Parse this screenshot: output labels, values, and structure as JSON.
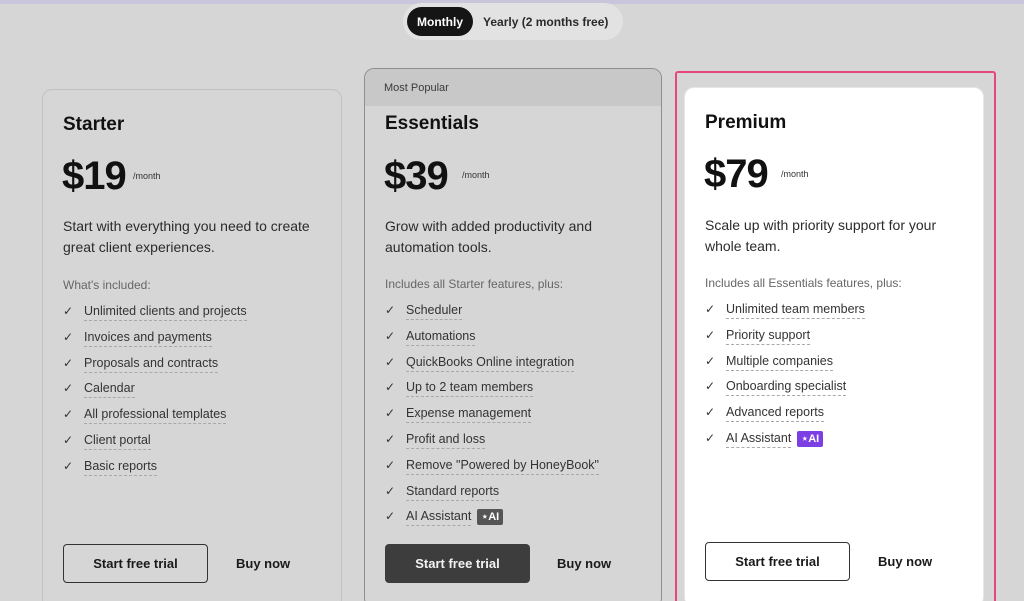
{
  "billing_toggle": {
    "monthly_label": "Monthly",
    "yearly_label": "Yearly (2 months free)",
    "selected": "Monthly"
  },
  "plans": [
    {
      "name": "Starter",
      "price": "$19",
      "period": "/month",
      "description": "Start with everything you need to create great client experiences.",
      "includes_label": "What's included:",
      "features": [
        "Unlimited clients and projects",
        "Invoices and payments",
        "Proposals and contracts",
        "Calendar",
        "All professional templates",
        "Client portal",
        "Basic reports"
      ],
      "trial_label": "Start free trial",
      "buy_label": "Buy now"
    },
    {
      "badge": "Most Popular",
      "name": "Essentials",
      "price": "$39",
      "period": "/month",
      "description": "Grow with added productivity and automation tools.",
      "includes_label": "Includes all Starter features, plus:",
      "features": [
        "Scheduler",
        "Automations",
        "QuickBooks Online integration",
        "Up to 2 team members",
        "Expense management",
        "Profit and loss",
        "Remove \"Powered by HoneyBook\"",
        "Standard reports",
        "AI Assistant"
      ],
      "ai_badge": "AI",
      "trial_label": "Start free trial",
      "buy_label": "Buy now"
    },
    {
      "name": "Premium",
      "price": "$79",
      "period": "/month",
      "description": "Scale up with priority support for your whole team.",
      "includes_label": "Includes all Essentials features, plus:",
      "features": [
        "Unlimited team members",
        "Priority support",
        "Multiple companies",
        "Onboarding specialist",
        "Advanced reports",
        "AI Assistant"
      ],
      "ai_badge": "AI",
      "trial_label": "Start free trial",
      "buy_label": "Buy now"
    }
  ],
  "colors": {
    "highlight_border": "#e8457e",
    "ai_badge_premium": "#7b3fe4",
    "ai_badge_muted": "#555555"
  }
}
